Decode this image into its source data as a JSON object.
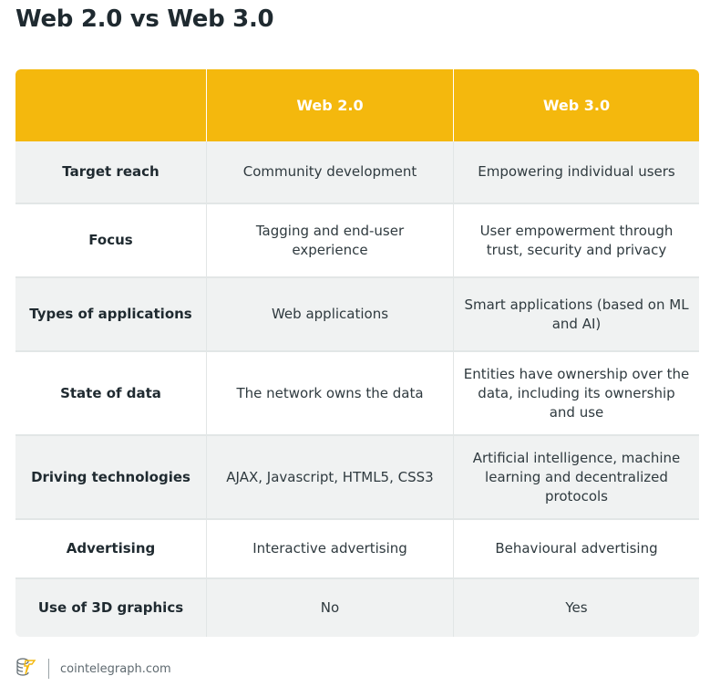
{
  "title": "Web 2.0 vs Web 3.0",
  "table": {
    "headers": [
      "",
      "Web 2.0",
      "Web 3.0"
    ],
    "rows": [
      {
        "label": "Target reach",
        "web2": "Community development",
        "web3": "Empowering individual users"
      },
      {
        "label": "Focus",
        "web2": "Tagging and end-user experience",
        "web3": "User empowerment through trust, security and privacy"
      },
      {
        "label": "Types of applications",
        "web2": "Web applications",
        "web3": "Smart applications (based on  ML and AI)"
      },
      {
        "label": "State of data",
        "web2": "The network owns the data",
        "web3": "Entities have ownership over the data, including its ownership and use"
      },
      {
        "label": "Driving technologies",
        "web2": "AJAX, Javascript, HTML5, CSS3",
        "web3": "Artificial intelligence, machine learning and decentralized protocols"
      },
      {
        "label": "Advertising",
        "web2": "Interactive advertising",
        "web3": "Behavioural advertising"
      },
      {
        "label": "Use of 3D graphics",
        "web2": "No",
        "web3": "Yes"
      }
    ]
  },
  "footer": {
    "logo_icon": "cointelegraph-logo-icon",
    "site": "cointelegraph.com"
  },
  "colors": {
    "header": "#f4b80d",
    "stripe": "#f0f2f2"
  }
}
